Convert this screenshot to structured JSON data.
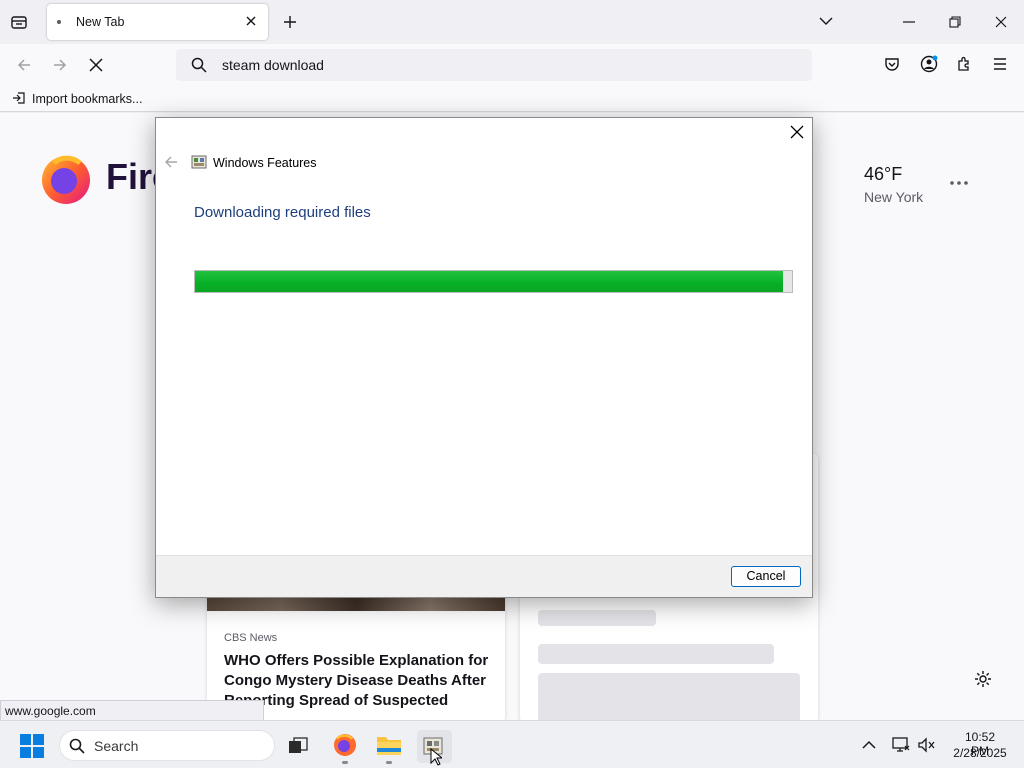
{
  "browser": {
    "tab_title": "New Tab",
    "url_text": "steam download",
    "bookmarks_label": "Import bookmarks...",
    "status_url": "www.google.com"
  },
  "newtab": {
    "brand_partial": "Fire",
    "weather": {
      "temp": "46°F",
      "city": "New York"
    },
    "news": {
      "source": "CBS News",
      "headline": "WHO Offers Possible Explanation for Congo Mystery Disease Deaths After Reporting Spread of Suspected Cases"
    }
  },
  "dialog": {
    "title": "Windows Features",
    "heading": "Downloading required files",
    "progress_fraction": 0.985,
    "cancel_label": "Cancel"
  },
  "taskbar": {
    "search_label": "Search",
    "time": "10:52 PM",
    "date": "2/28/2025"
  },
  "colors": {
    "progress": "#06b025",
    "dialog_heading": "#1e3f7e",
    "accent": "#0067c0"
  }
}
